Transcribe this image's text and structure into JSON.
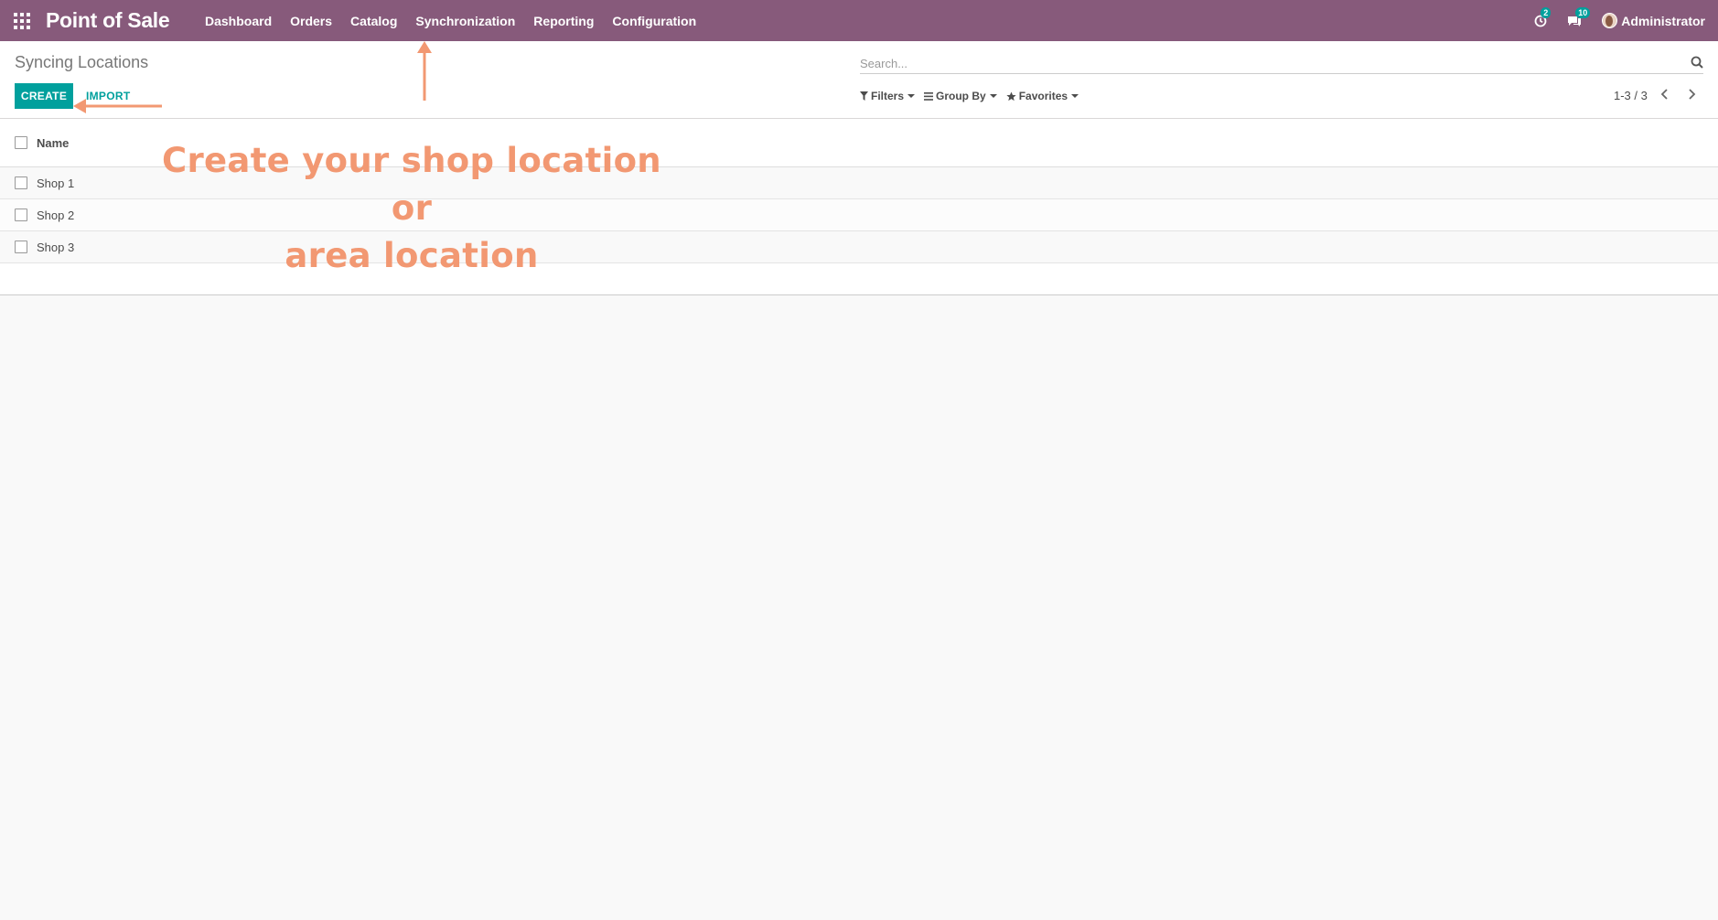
{
  "navbar": {
    "brand": "Point of Sale",
    "menu": [
      "Dashboard",
      "Orders",
      "Catalog",
      "Synchronization",
      "Reporting",
      "Configuration"
    ],
    "activity_count": "2",
    "message_count": "10",
    "user_name": "Administrator"
  },
  "control_panel": {
    "title": "Syncing Locations",
    "create_label": "CREATE",
    "import_label": "IMPORT",
    "search_placeholder": "Search...",
    "filters_label": "Filters",
    "group_by_label": "Group By",
    "favorites_label": "Favorites",
    "pager": "1-3 / 3"
  },
  "list": {
    "column_name": "Name",
    "rows": [
      "Shop 1",
      "Shop 2",
      "Shop 3"
    ]
  },
  "annotation": {
    "line1": "Create your shop location or",
    "line2": "area location",
    "color": "#f29872"
  },
  "colors": {
    "navbar": "#875a7b",
    "primary": "#00a09d"
  }
}
